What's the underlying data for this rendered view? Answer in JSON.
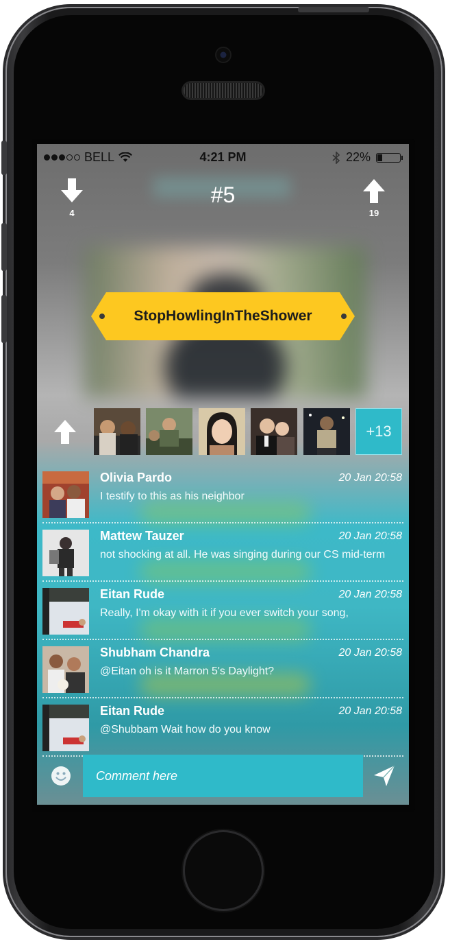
{
  "status_bar": {
    "carrier": "BELL",
    "time": "4:21 PM",
    "battery_percent": "22%",
    "signal_bars_filled": 3,
    "signal_bars_total": 5,
    "battery_level": 0.22
  },
  "header": {
    "downvotes": "4",
    "rank": "#5",
    "upvotes": "19"
  },
  "tag": {
    "label": "StopHowlingInTheShower",
    "color": "#fdc820"
  },
  "participants": {
    "more_count": "+13",
    "accent": "#2fbac9"
  },
  "comments": [
    {
      "name": "Olivia Pardo",
      "time": "20 Jan 20:58",
      "text": "I testify to this as his neighbor"
    },
    {
      "name": "Mattew Tauzer",
      "time": "20 Jan 20:58",
      "text": "not shocking at all. He was singing during our CS mid-term"
    },
    {
      "name": "Eitan Rude",
      "time": "20 Jan 20:58",
      "text": "Really, I'm okay with it if you ever switch your song,"
    },
    {
      "name": "Shubham Chandra",
      "time": "20 Jan 20:58",
      "text": "@Eitan oh is it Marron 5's Daylight?"
    },
    {
      "name": "Eitan Rude",
      "time": "20 Jan 20:58",
      "text": "@Shubbam Wait how do you know"
    }
  ],
  "composer": {
    "placeholder": "Comment here",
    "emoji_icon": "smiley-icon",
    "send_icon": "send-icon"
  }
}
